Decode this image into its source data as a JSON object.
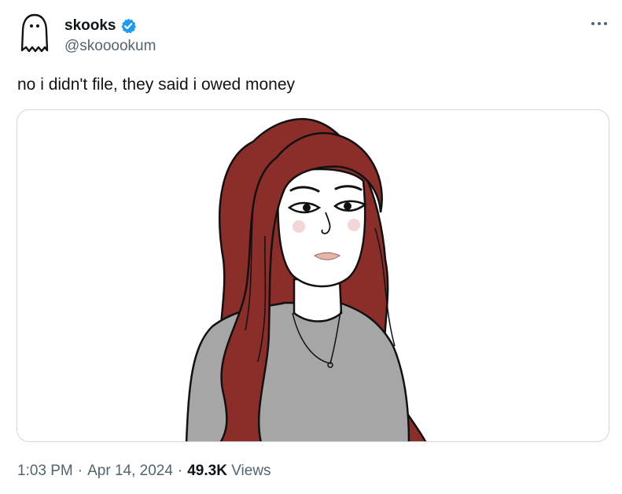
{
  "author": {
    "display_name": "skooks",
    "handle": "@skooookum",
    "verified": true,
    "avatar_icon": "ghost-icon"
  },
  "tweet": {
    "text": "no i didn't file, they said i owed money",
    "media": {
      "description_icon": "cartoon-woman-illustration"
    }
  },
  "meta": {
    "time": "1:03 PM",
    "date": "Apr 14, 2024",
    "views_count": "49.3K",
    "views_label": "Views",
    "separator": "·"
  },
  "colors": {
    "text_primary": "#0f1419",
    "text_secondary": "#536471",
    "verified_blue": "#1d9bf0",
    "hair": "#8b2e2a",
    "sweater": "#a6a6a6"
  }
}
